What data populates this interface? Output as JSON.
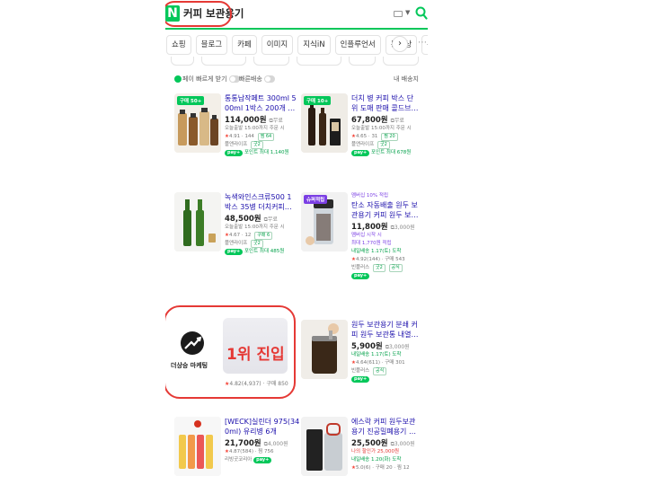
{
  "search": {
    "logo": "N",
    "query": "커피 보관용기",
    "icons": [
      "keyboard-icon",
      "chevron-down-icon",
      "search-icon"
    ]
  },
  "tabs": [
    "쇼핑",
    "블로그",
    "카페",
    "이미지",
    "지식iN",
    "인플루언서",
    "동영상",
    "뉴스",
    "쇼"
  ],
  "tabs_next": "›",
  "tabs_more": "⋯",
  "filters": {
    "npay_label": "페이",
    "fast_pay": "빠르게 받기",
    "fast_ship": "빠른배송",
    "my_delivery": "내 배송지"
  },
  "products": [
    {
      "badge": "구매 50+",
      "title_a": "통통납작페트 300ml 5",
      "title_b": "00ml 1박스 200개 …",
      "price": "114,000원",
      "ship": "무료",
      "today": "오늘출발 15:00까지 주문 시",
      "rating": "4.91",
      "count": "144",
      "chip": "찜 64",
      "seller": "플앤라이프",
      "seller_chip": "굿2",
      "pay": "pay+",
      "point": "포인트 최대 1,140원"
    },
    {
      "badge": "구매 10+",
      "title_a": "더치 병 커피 박스 단",
      "title_b": "위 도매 판매 콜드브…",
      "price": "67,800원",
      "ship": "무료",
      "today": "오늘출발 15:00까지 주문 시",
      "rating": "4.65",
      "count": "31",
      "chip": "찜 20",
      "seller": "플앤라이프",
      "seller_chip": "굿2",
      "pay": "pay+",
      "point": "포인트 최대 678원"
    },
    {
      "title_a": "녹색와인스크류500 1",
      "title_b": "박스 35병 더치커피…",
      "price": "48,500원",
      "ship": "무료",
      "today": "오늘출발 15:00까지 주문 시",
      "rating": "4.67",
      "count": "12",
      "chip": "구매 6",
      "seller": "플앤라이프",
      "seller_chip": "굿2",
      "pay": "pay+",
      "point": "포인트 최대 485원"
    },
    {
      "badge": "슈퍼적립",
      "member": "멤버십 10% 적립",
      "title_a": "탄소 자동배출 원두 보",
      "title_b": "관용기 커피 원두 보…",
      "price": "11,800원",
      "ship": "3,000원",
      "member2": "멤버십 시작 시",
      "member3": "최대 1,770원 적립",
      "arrival": "내일배송 1.17(토) 도착",
      "rating_line": "4.92(144) · 구매 543",
      "seller": "빈플러스",
      "seller_chip": "굿2",
      "extra_chip": "공식",
      "pay": "pay+"
    },
    {
      "title_a": "원두 보관용기 분쇄 커",
      "title_b": "피 원두 보관통 내열…",
      "price": "5,900원",
      "ship": "3,000원",
      "arrival": "내일배송 1.17(토) 도착",
      "rating_line": "4.64(611) · 구매 301",
      "seller": "빈플러스",
      "extra_chip": "공식",
      "pay": "pay+"
    },
    {
      "title_a": "[WECK]실린더 975(34",
      "title_b": "0ml) 유리병 6개",
      "price": "21,700원",
      "ship": "4,000원",
      "rating_line": "4.87(584) · 찜 756",
      "seller": "리빙굿코리아",
      "pay": "pay+"
    },
    {
      "title_a": "에스락 커피 원두보관",
      "title_b": "용기 진공밀폐용기 …",
      "price": "25,500원",
      "ship": "3,000원",
      "sale": "나의 할인가 25,000원",
      "arrival": "내일배송 1.20(화) 도착",
      "rating_line": "5.0(6) · 구매 20 · 찜 12"
    }
  ],
  "ad": {
    "brand": "더상승 마케팅",
    "headline": "1위 진입",
    "rating_line": "4.82(4,937) · 구매 850"
  },
  "colors": {
    "naver_green": "#03c75a",
    "highlight_red": "#e53935",
    "link_blue": "#1a0dab"
  }
}
